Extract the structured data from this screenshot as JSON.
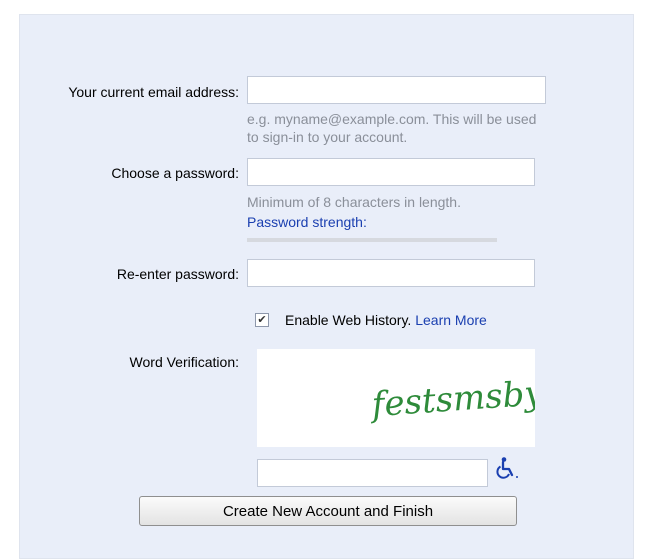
{
  "form": {
    "email": {
      "label": "Your current email address:",
      "value": "",
      "hint_line1": "e.g. myname@example.com. This will be used",
      "hint_line2": "to sign-in to your account."
    },
    "password": {
      "label": "Choose a password:",
      "value": "",
      "hint": "Minimum of 8 characters in length.",
      "strength_label": "Password strength:"
    },
    "reenter": {
      "label": "Re-enter password:",
      "value": ""
    },
    "web_history": {
      "label": "Enable Web History.",
      "checked": true,
      "learn_more": "Learn More"
    },
    "verification": {
      "label": "Word Verification:",
      "captcha_text": "festsmsbyl",
      "captcha_color": "#2e8b3a",
      "value": "",
      "accessibility_icon": "wheelchair-icon"
    },
    "submit_label": "Create New Account and Finish"
  },
  "colors": {
    "panel_background": "#e9eef9",
    "link": "#1a3fb0",
    "hint": "#8a8f99"
  }
}
